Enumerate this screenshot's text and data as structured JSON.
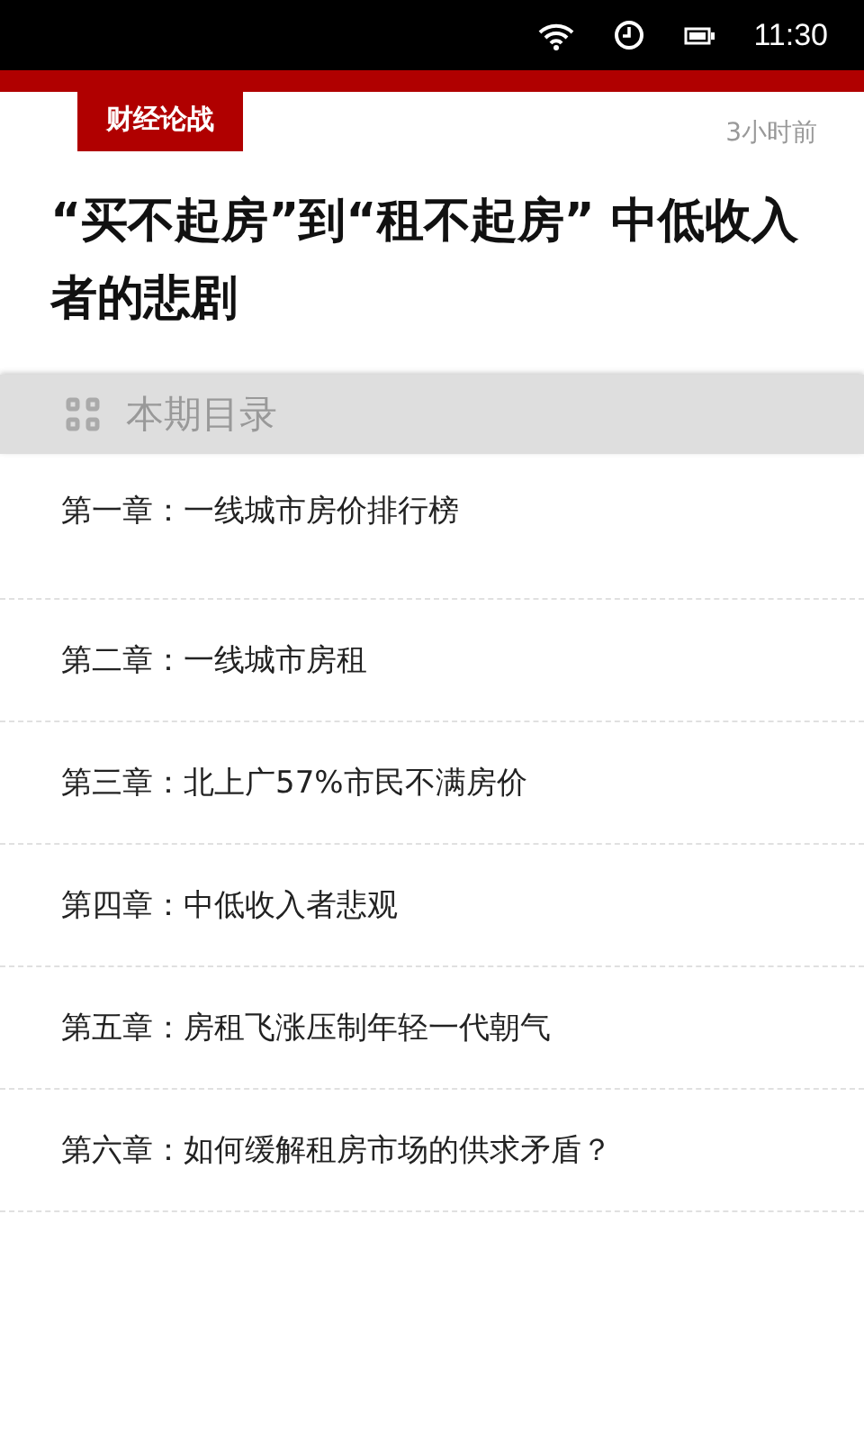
{
  "status_bar": {
    "time": "11:30"
  },
  "article": {
    "category": "财经论战",
    "time": "3小时前",
    "title": "“买不起房”到“租不起房”  中低收入者的悲剧"
  },
  "contents": {
    "heading": "本期目录",
    "chapters": [
      {
        "label": "第一章：一线城市房价排行榜"
      },
      {
        "label": "第二章：一线城市房租"
      },
      {
        "label": "第三章：北上广57%市民不满房价"
      },
      {
        "label": "第四章：中低收入者悲观"
      },
      {
        "label": "第五章：房租飞涨压制年轻一代朝气"
      },
      {
        "label": "第六章：如何缓解租房市场的供求矛盾？"
      }
    ]
  }
}
